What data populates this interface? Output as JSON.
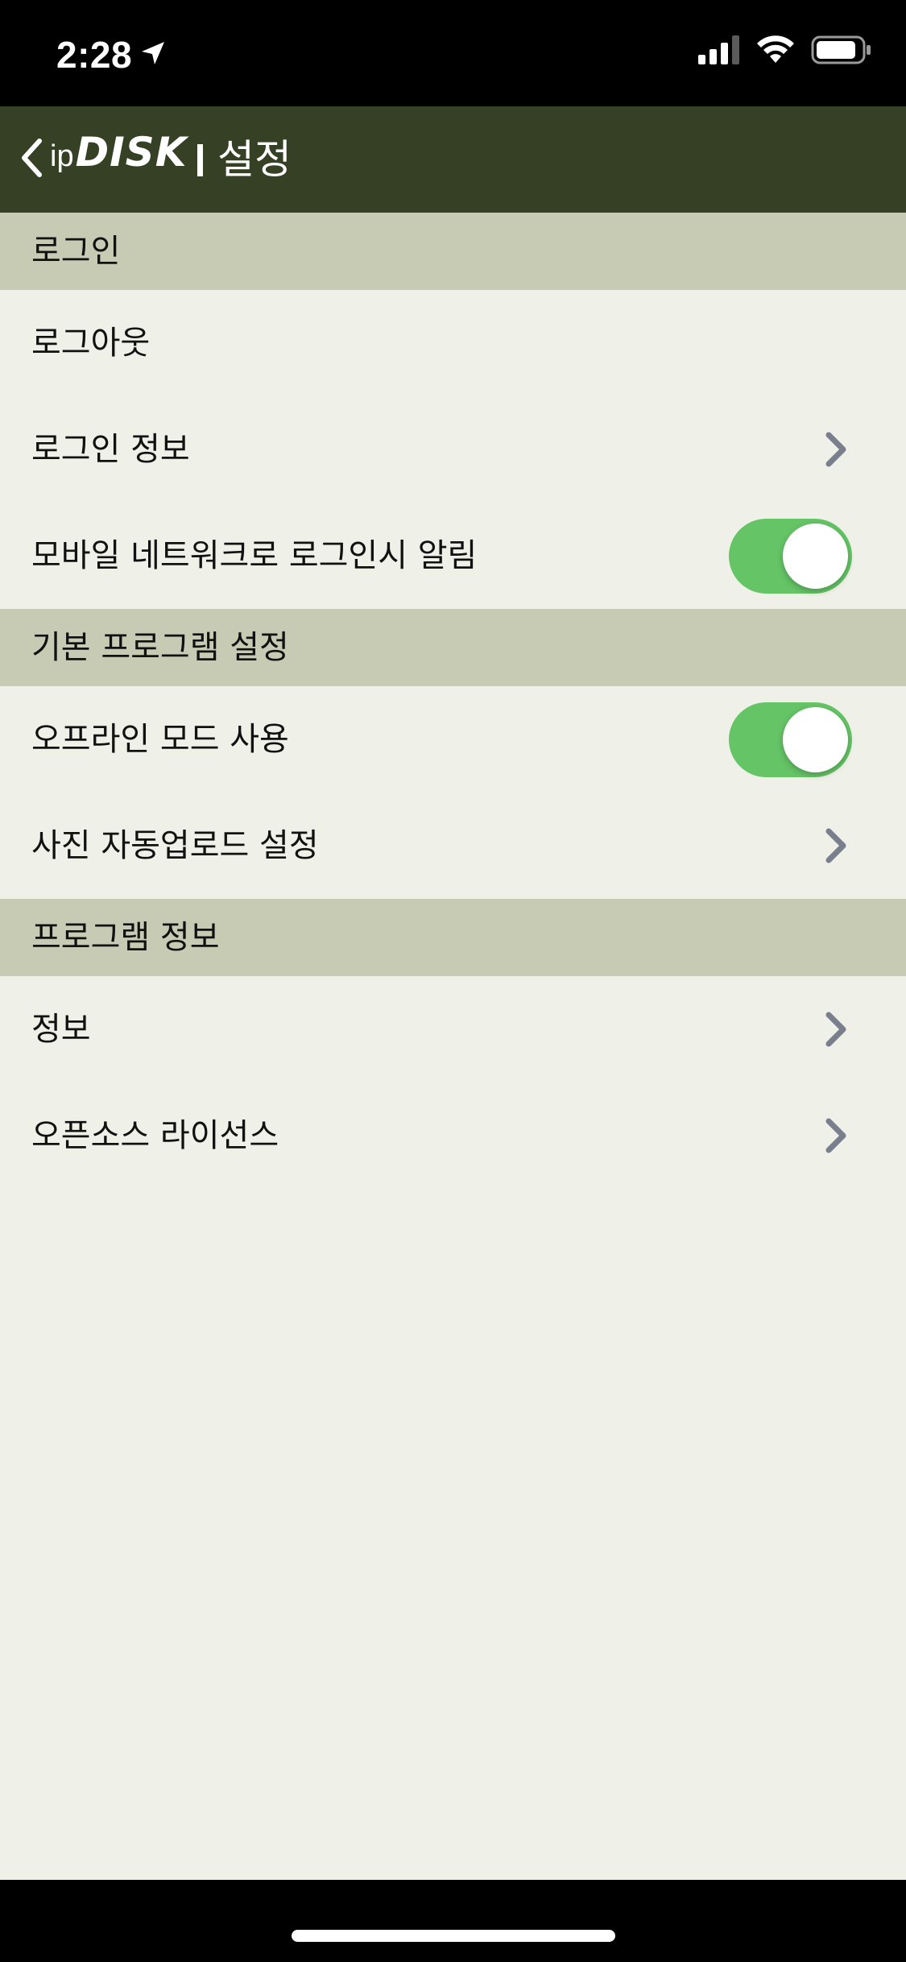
{
  "status_bar": {
    "time": "2:28",
    "location_icon": "location-arrow-icon",
    "signal_icon": "cellular-signal-icon",
    "wifi_icon": "wifi-icon",
    "battery_icon": "battery-icon"
  },
  "nav": {
    "back_icon": "chevron-left-icon",
    "logo_ip": "ip",
    "logo_disk": "DISK",
    "title": "설정"
  },
  "sections": [
    {
      "header": "로그인",
      "items": [
        {
          "label": "로그아웃"
        },
        {
          "label": "로그인 정보",
          "accessory": "chevron-right-icon"
        },
        {
          "label": "모바일 네트워크로 로그인시 알림",
          "toggle": true
        }
      ]
    },
    {
      "header": "기본 프로그램 설정",
      "items": [
        {
          "label": "오프라인 모드 사용",
          "toggle": true
        },
        {
          "label": "사진 자동업로드 설정",
          "accessory": "chevron-right-icon"
        }
      ]
    },
    {
      "header": "프로그램 정보",
      "items": [
        {
          "label": "정보",
          "accessory": "chevron-right-icon"
        },
        {
          "label": "오픈소스 라이선스",
          "accessory": "chevron-right-icon"
        }
      ]
    }
  ],
  "colors": {
    "nav_background": "#354025",
    "section_header_background": "#c8cbb4",
    "content_background": "#eff0e7",
    "toggle_on": "#65c466",
    "chevron": "#7a7f8e"
  }
}
